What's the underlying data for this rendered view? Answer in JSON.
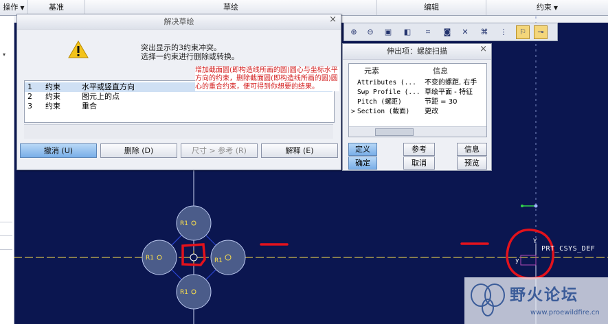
{
  "menubar": {
    "items": [
      {
        "label": "操作",
        "caret": "▼"
      },
      {
        "label": "基准",
        "caret": ""
      },
      {
        "label": "草绘",
        "caret": ""
      },
      {
        "label": "编辑",
        "caret": ""
      },
      {
        "label": "约束",
        "caret": "▼"
      }
    ]
  },
  "toolbar": {
    "icons": [
      "zoom-in-icon",
      "zoom-out-icon",
      "refit-icon",
      "shading-icon",
      "datum-display-icon",
      "camera-icon",
      "constraint-display-icon",
      "grid-display-icon",
      "vertex-display-icon",
      "sketch-orient-icon",
      "dimension-display-icon"
    ]
  },
  "resolve_dialog": {
    "title": "解决草绘",
    "close": "×",
    "message_line1": "突出显示的3约束冲突。",
    "message_line2": "选择一约束进行删除或转换。",
    "rows": [
      {
        "num": "1",
        "type": "约束",
        "desc": "水平或竖直方向"
      },
      {
        "num": "2",
        "type": "约束",
        "desc": "图元上的点"
      },
      {
        "num": "3",
        "type": "约束",
        "desc": "重合"
      }
    ],
    "buttons": {
      "undo": "撤消 (U)",
      "delete": "删除 (D)",
      "dim_to_ref": "尺寸 > 参考 (R)",
      "explain": "解释 (E)"
    }
  },
  "annotation": {
    "text": "增加截面圆(即构造线所画的圆)圆心与坐标水平方向的约束，删除截面圆(即构造线所画的圆)圆心的重合约束，便可得到你想要的结果。"
  },
  "sweep_dialog": {
    "title": "伸出项：螺旋扫描",
    "close": "×",
    "col_element": "元素",
    "col_info": "信息",
    "rows": [
      {
        "arrow": "",
        "element": "Attributes (...",
        "info": "不变的螺距, 右手"
      },
      {
        "arrow": "",
        "element": "Swp Profile (...",
        "info": "草绘平面 - 特征"
      },
      {
        "arrow": "",
        "element": "Pitch (螺距)",
        "info": "节距 = 30"
      },
      {
        "arrow": ">",
        "element": "Section (截面)",
        "info": "更改"
      }
    ],
    "buttons": {
      "define": "定义",
      "reference": "参考",
      "info": "信息",
      "ok": "确定",
      "cancel": "取消",
      "preview": "预览"
    }
  },
  "canvas": {
    "csys_label": "PRT_CSYS_DEF",
    "x_axis_label": "y",
    "y_axis_label": "Y",
    "circle_label": "R1",
    "colors": {
      "background": "#0b1650",
      "sketch": "#ffe24a",
      "construction": "#bcc9ef",
      "markup": "#e3121c"
    }
  },
  "watermark": {
    "name": "野火论坛",
    "url": "www.proewildfire.cn"
  }
}
